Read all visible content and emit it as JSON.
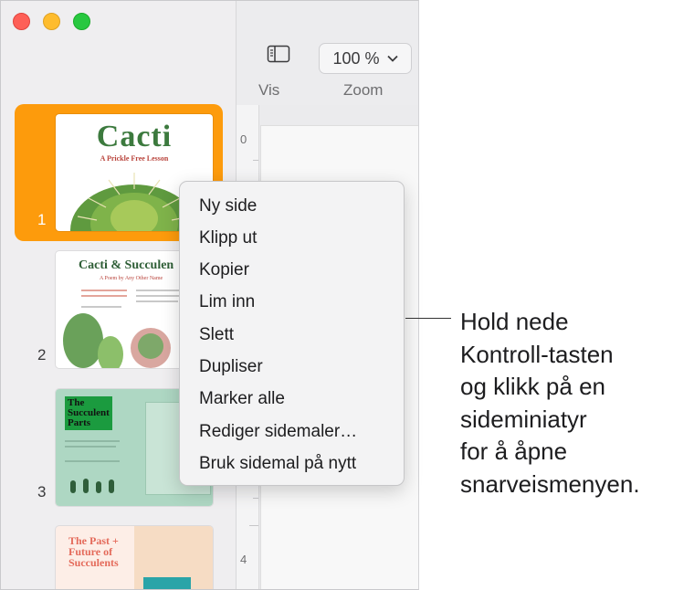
{
  "toolbar": {
    "view_label": "Vis",
    "zoom_value": "100 %",
    "zoom_label": "Zoom"
  },
  "ruler": {
    "marks": [
      "0",
      "4"
    ]
  },
  "pages": [
    {
      "number": "1",
      "title": "Cacti",
      "subtitle": "A Prickle Free Lesson",
      "selected": true
    },
    {
      "number": "2",
      "title": "Cacti & Succulen",
      "subtitle": "A Poem by Any Other Name"
    },
    {
      "number": "3",
      "title_lines": [
        "The",
        "Succulent",
        "Parts"
      ]
    },
    {
      "number": "",
      "title_lines": [
        "The Past +",
        "Future of",
        "Succulents"
      ]
    }
  ],
  "context_menu": {
    "items": [
      "Ny side",
      "Klipp ut",
      "Kopier",
      "Lim inn",
      "Slett",
      "Dupliser",
      "Marker alle",
      "Rediger sidemaler…",
      "Bruk sidemal på nytt"
    ]
  },
  "callout": {
    "lines": [
      "Hold nede",
      "Kontroll-tasten",
      "og klikk på en",
      "sideminiatyr",
      "for å åpne",
      "snarveismenyen."
    ]
  },
  "colors": {
    "selection": "#fd9b0c",
    "close": "#fe5f57",
    "minimize": "#febc2e",
    "maximize": "#28c840"
  }
}
